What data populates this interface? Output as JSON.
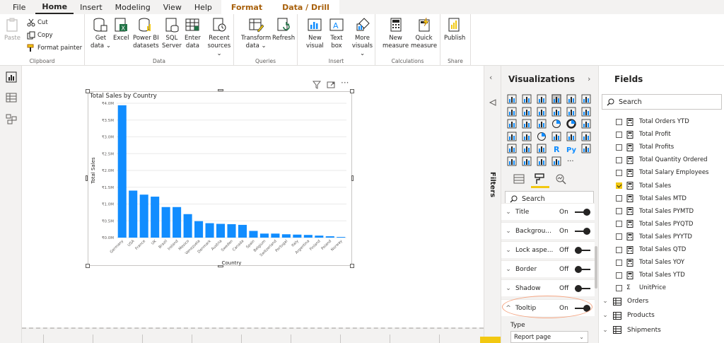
{
  "menu": {
    "items": [
      "File",
      "Home",
      "Insert",
      "Modeling",
      "View",
      "Help"
    ],
    "active": "Home",
    "context_tabs": [
      "Format",
      "Data / Drill"
    ]
  },
  "ribbon": {
    "clipboard": {
      "label": "Clipboard",
      "paste": "Paste",
      "cut": "Cut",
      "copy": "Copy",
      "format_painter": "Format painter"
    },
    "data": {
      "label": "Data",
      "get_data": [
        "Get",
        "data ⌄"
      ],
      "excel": [
        "Excel"
      ],
      "power_bi": [
        "Power BI",
        "datasets"
      ],
      "sql": [
        "SQL",
        "Server"
      ],
      "enter_data": [
        "Enter",
        "data"
      ],
      "recent": [
        "Recent",
        "sources ⌄"
      ]
    },
    "queries": {
      "label": "Queries",
      "transform": [
        "Transform",
        "data ⌄"
      ],
      "refresh": [
        "Refresh"
      ]
    },
    "insert": {
      "label": "Insert",
      "new_visual": [
        "New",
        "visual"
      ],
      "text_box": [
        "Text",
        "box"
      ],
      "more_visuals": [
        "More",
        "visuals ⌄"
      ]
    },
    "calculations": {
      "label": "Calculations",
      "new_measure": [
        "New",
        "measure"
      ],
      "quick_measure": [
        "Quick",
        "measure"
      ]
    },
    "share": {
      "label": "Share",
      "publish": [
        "Publish"
      ]
    }
  },
  "chart_data": {
    "type": "bar",
    "title": "Total Sales by Country",
    "xlabel": "Country",
    "ylabel": "Total Sales",
    "ylim": [
      0,
      4.0
    ],
    "yticks": [
      "₹0.0M",
      "₹0.5M",
      "₹1.0M",
      "₹1.5M",
      "₹2.0M",
      "₹2.5M",
      "₹3.0M",
      "₹3.5M",
      "₹4.0M"
    ],
    "categories": [
      "Germany",
      "USA",
      "France",
      "UK",
      "Brazil",
      "Ireland",
      "Mexico",
      "Venezuela",
      "Denmark",
      "Austria",
      "Sweden",
      "Canada",
      "Spain",
      "Belgium",
      "Switzerland",
      "Portugal",
      "Italy",
      "Argentina",
      "Finland",
      "Poland",
      "Norway"
    ],
    "values": [
      3.94,
      1.4,
      1.28,
      1.22,
      0.91,
      0.91,
      0.7,
      0.49,
      0.43,
      0.41,
      0.4,
      0.38,
      0.2,
      0.12,
      0.12,
      0.1,
      0.09,
      0.08,
      0.06,
      0.04,
      0.02
    ],
    "bar_color": "#118dff",
    "grid": true
  },
  "filters_label": "Filters",
  "viz_pane": {
    "title": "Visualizations",
    "search_placeholder": "Search",
    "more_icon": "···",
    "cards": [
      {
        "name": "Title",
        "state": "On",
        "on": true
      },
      {
        "name": "Backgrou...",
        "state": "On",
        "on": true
      },
      {
        "name": "Lock aspe...",
        "state": "Off",
        "on": false
      },
      {
        "name": "Border",
        "state": "Off",
        "on": false
      },
      {
        "name": "Shadow",
        "state": "Off",
        "on": false
      },
      {
        "name": "Tooltip",
        "state": "On",
        "on": true
      }
    ],
    "type_label": "Type",
    "type_value": "Report page"
  },
  "fields_pane": {
    "title": "Fields",
    "search_placeholder": "Search",
    "measures": [
      {
        "name": "Total Orders YTD",
        "checked": false
      },
      {
        "name": "Total Profit",
        "checked": false
      },
      {
        "name": "Total Profits",
        "checked": false
      },
      {
        "name": "Total Quantity Ordered",
        "checked": false
      },
      {
        "name": "Total Salary Employees",
        "checked": false
      },
      {
        "name": "Total Sales",
        "checked": true
      },
      {
        "name": "Total Sales MTD",
        "checked": false
      },
      {
        "name": "Total Sales PYMTD",
        "checked": false
      },
      {
        "name": "Total Sales PYQTD",
        "checked": false
      },
      {
        "name": "Total Sales PYYTD",
        "checked": false
      },
      {
        "name": "Total Sales QTD",
        "checked": false
      },
      {
        "name": "Total Sales YOY",
        "checked": false
      },
      {
        "name": "Total Sales YTD",
        "checked": false
      },
      {
        "name": "UnitPrice",
        "checked": false,
        "sigma": true
      }
    ],
    "tables": [
      "Orders",
      "Products",
      "Shipments"
    ]
  },
  "colors": {
    "accent": "#f2c811",
    "bar": "#118dff",
    "highlight_ring": "#f4a582"
  }
}
